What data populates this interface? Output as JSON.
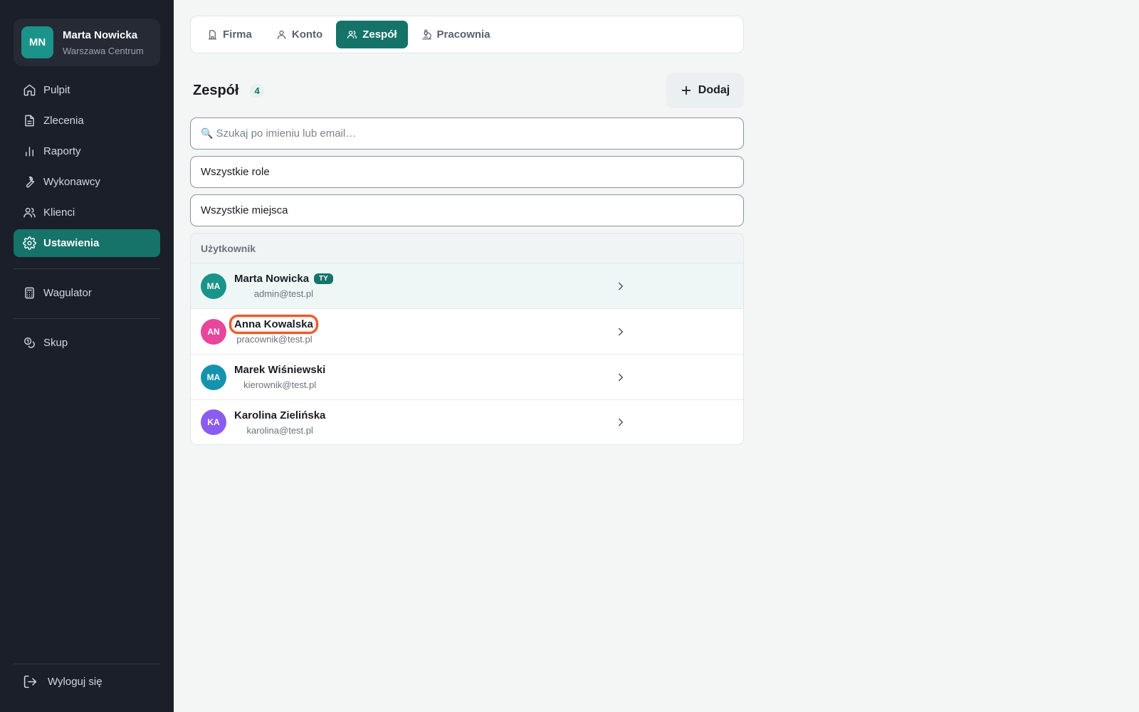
{
  "profile": {
    "initials": "MN",
    "name": "Marta Nowicka",
    "location": "Warszawa Centrum"
  },
  "nav": {
    "items": [
      {
        "label": "Pulpit",
        "icon": "home-icon"
      },
      {
        "label": "Zlecenia",
        "icon": "document-icon"
      },
      {
        "label": "Raporty",
        "icon": "bar-chart-icon"
      },
      {
        "label": "Wykonawcy",
        "icon": "wrench-icon"
      },
      {
        "label": "Klienci",
        "icon": "users-icon"
      },
      {
        "label": "Ustawienia",
        "icon": "gear-icon",
        "active": true
      }
    ],
    "extra1": {
      "label": "Wagulator",
      "icon": "calculator-icon"
    },
    "extra2": {
      "label": "Skup",
      "icon": "coins-icon"
    },
    "logout": "Wyloguj się"
  },
  "tabs": [
    {
      "label": "Firma",
      "icon": "building-icon"
    },
    {
      "label": "Konto",
      "icon": "user-icon"
    },
    {
      "label": "Zespół",
      "icon": "users-icon",
      "active": true
    },
    {
      "label": "Pracownia",
      "icon": "microscope-icon"
    }
  ],
  "header": {
    "title": "Zespół",
    "count": "4",
    "add_label": "Dodaj"
  },
  "filters": {
    "search_placeholder": "Szukaj po imieniu lub email…",
    "role": "Wszystkie role",
    "place": "Wszystkie miejsca"
  },
  "table": {
    "column": "Użytkownik",
    "rows": [
      {
        "initials": "MA",
        "name": "Marta Nowicka",
        "email": "admin@test.pl",
        "badge": "TY",
        "color": "#1a948a"
      },
      {
        "initials": "AN",
        "name": "Anna Kowalska",
        "email": "pracownik@test.pl",
        "color": "#e6479a"
      },
      {
        "initials": "MA",
        "name": "Marek Wiśniewski",
        "email": "kierownik@test.pl",
        "color": "#1493ae"
      },
      {
        "initials": "KA",
        "name": "Karolina Zielińska",
        "email": "karolina@test.pl",
        "color": "#8b5cf0"
      }
    ]
  },
  "colors": {
    "accent": "#15736a",
    "sidebar": "#1b1f29",
    "focus": "#e8592b"
  }
}
